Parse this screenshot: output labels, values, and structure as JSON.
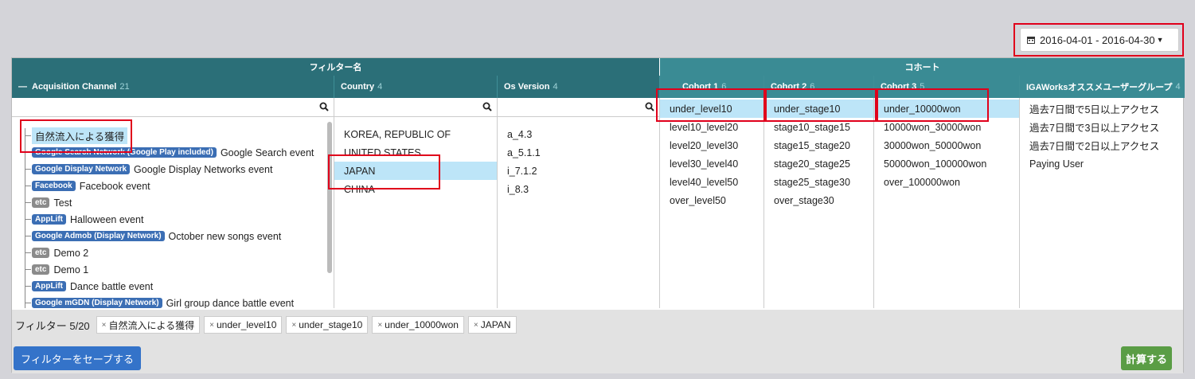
{
  "colors": {
    "header_dark": "#2b6f78",
    "header_group": "#3a8b94",
    "selection": "#bde5f8",
    "highlight_box": "#e0001b",
    "save_button": "#3473c9",
    "calc_button": "#5a9d45",
    "tag_blue": "#3b6eb4",
    "tag_etc": "#8b8b8b"
  },
  "date_range": {
    "label": "2016-04-01 - 2016-04-30",
    "icon": "calendar-icon"
  },
  "groups": {
    "filter_name": "フィルター名",
    "cohort": "コホート"
  },
  "columns": {
    "acquisition": {
      "title": "Acquisition Channel",
      "count": "21",
      "collapse": "—"
    },
    "country": {
      "title": "Country",
      "count": "4"
    },
    "os": {
      "title": "Os Version",
      "count": "4"
    },
    "cohort1": {
      "title": "Cohort 1",
      "count": "6"
    },
    "cohort2": {
      "title": "Cohort 2",
      "count": "6"
    },
    "cohort3": {
      "title": "Cohort 3",
      "count": "5"
    },
    "iga": {
      "title": "IGAWorksオススメユーザーグループ",
      "count": "4"
    }
  },
  "acquisition_items": [
    {
      "tag": "",
      "label": "自然流入による獲得"
    },
    {
      "tag": "Google Search Network (Google Play included)",
      "label": "Google Search event"
    },
    {
      "tag": "Google Display Network",
      "label": "Google Display Networks event"
    },
    {
      "tag": "Facebook",
      "label": "Facebook event"
    },
    {
      "tag": "etc",
      "label": "Test"
    },
    {
      "tag": "AppLift",
      "label": "Halloween event"
    },
    {
      "tag": "Google Admob (Display Network)",
      "label": "October new songs event"
    },
    {
      "tag": "etc",
      "label": "Demo 2"
    },
    {
      "tag": "etc",
      "label": "Demo 1"
    },
    {
      "tag": "AppLift",
      "label": "Dance battle event"
    },
    {
      "tag": "Google mGDN (Display Network)",
      "label": "Girl group dance battle event"
    }
  ],
  "country_items": [
    "KOREA, REPUBLIC OF",
    "UNITED STATES",
    "JAPAN",
    "CHINA"
  ],
  "os_items": [
    "a_4.3",
    "a_5.1.1",
    "i_7.1.2",
    "i_8.3"
  ],
  "cohort1_items": [
    "under_level10",
    "level10_level20",
    "level20_level30",
    "level30_level40",
    "level40_level50",
    "over_level50"
  ],
  "cohort2_items": [
    "under_stage10",
    "stage10_stage15",
    "stage15_stage20",
    "stage20_stage25",
    "stage25_stage30",
    "over_stage30"
  ],
  "cohort3_items": [
    "under_10000won",
    "10000won_30000won",
    "30000won_50000won",
    "50000won_100000won",
    "over_100000won"
  ],
  "iga_items": [
    "過去7日間で5日以上アクセス",
    "過去7日間で3日以上アクセス",
    "過去7日間で2日以上アクセス",
    "Paying User"
  ],
  "filter_bar": {
    "label": "フィルター 5/20",
    "chips": [
      "自然流入による獲得",
      "under_level10",
      "under_stage10",
      "under_10000won",
      "JAPAN"
    ]
  },
  "buttons": {
    "save": "フィルターをセーブする",
    "calc": "計算する"
  }
}
